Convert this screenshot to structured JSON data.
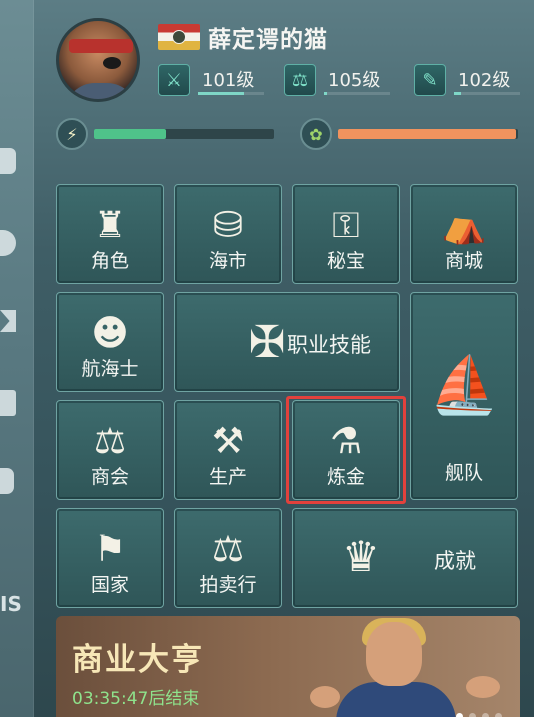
{
  "player": {
    "name": "薛定谔的猫",
    "stats": [
      {
        "icon": "crossed-swords-icon",
        "glyph": "⚔",
        "level": "101级",
        "progress": 0.7
      },
      {
        "icon": "scales-icon",
        "glyph": "⚖",
        "level": "105级",
        "progress": 0.05
      },
      {
        "icon": "spyglass-icon",
        "glyph": "✎",
        "level": "102级",
        "progress": 0.1
      }
    ],
    "energy": {
      "icon": "lightning-icon",
      "glyph": "⚡",
      "progress": 0.4
    },
    "food": {
      "icon": "food-icon",
      "glyph": "✿",
      "progress": 0.99
    }
  },
  "menu": {
    "role": {
      "label": "角色",
      "icon": "captain-bust-icon",
      "glyph": "♜"
    },
    "sea_market": {
      "label": "海市",
      "icon": "coin-stack-icon",
      "glyph": "⛁"
    },
    "treasure": {
      "label": "秘宝",
      "icon": "key-plaque-icon",
      "glyph": "⚿"
    },
    "mall": {
      "label": "商城",
      "icon": "shop-stall-icon",
      "glyph": "⛺"
    },
    "sailor": {
      "label": "航海士",
      "icon": "sailor-head-icon",
      "glyph": "☻"
    },
    "skills": {
      "label": "职业技能",
      "icon": "book-swords-icon",
      "glyph": "✠"
    },
    "fleet": {
      "label": "舰队",
      "icon": "galleon-icon",
      "glyph": "⛵"
    },
    "guild": {
      "label": "商会",
      "icon": "scales-banner-icon",
      "glyph": "⚖"
    },
    "production": {
      "label": "生产",
      "icon": "anvil-icon",
      "glyph": "⚒"
    },
    "alchemy": {
      "label": "炼金",
      "icon": "mortar-pestle-icon",
      "glyph": "⚗"
    },
    "nation": {
      "label": "国家",
      "icon": "flag-icon",
      "glyph": "⚑"
    },
    "auction": {
      "label": "拍卖行",
      "icon": "gavel-icon",
      "glyph": "⚖"
    },
    "achievement": {
      "label": "成就",
      "icon": "trophy-icon",
      "glyph": "♛"
    }
  },
  "event": {
    "title": "商业大亨",
    "timer": "03:35:47后结束"
  },
  "sidebar": {
    "partial_text": "IS"
  },
  "colors": {
    "highlight": "#e2413c",
    "energy": "#4fc38a",
    "food": "#f0935e",
    "timer": "#8fe38c"
  }
}
